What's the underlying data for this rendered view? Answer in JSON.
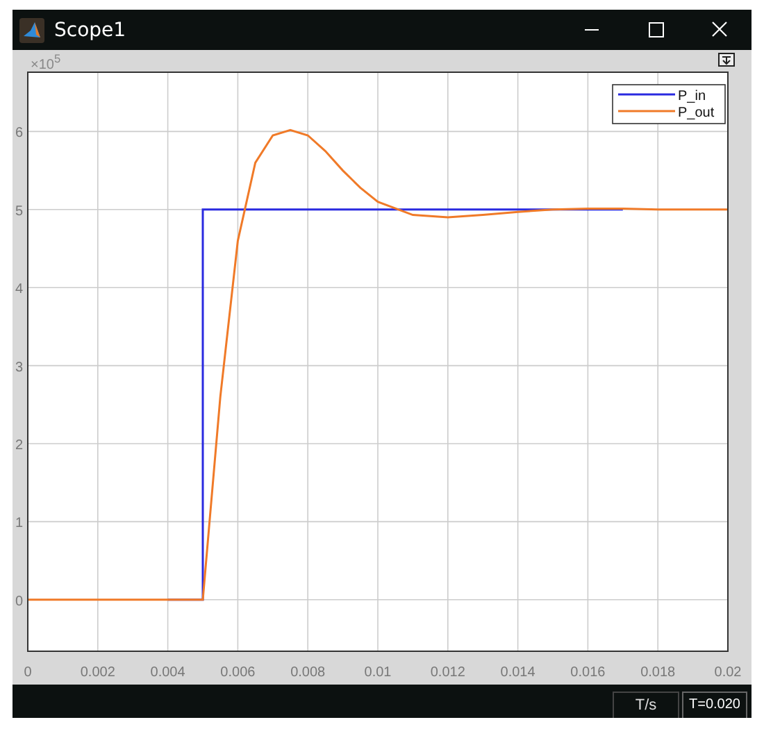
{
  "window": {
    "title": "Scope1"
  },
  "plot": {
    "multiplier": "×10$^{5}$",
    "chart_data": {
      "type": "line",
      "x": [
        0,
        0.001,
        0.002,
        0.003,
        0.004,
        0.005,
        0.005,
        0.0055,
        0.006,
        0.0065,
        0.007,
        0.0075,
        0.008,
        0.0085,
        0.009,
        0.0095,
        0.01,
        0.011,
        0.012,
        0.013,
        0.014,
        0.015,
        0.016,
        0.017,
        0.018,
        0.019,
        0.02
      ],
      "series": [
        {
          "name": "P_in",
          "color": "#2a2ae0",
          "values": [
            null,
            null,
            null,
            null,
            0,
            0,
            5,
            5,
            5,
            5,
            5,
            5,
            5,
            5,
            5,
            5,
            5,
            5,
            5,
            5,
            5,
            5,
            5,
            5,
            null,
            null,
            null
          ]
        },
        {
          "name": "P_out",
          "color": "#f07a28",
          "values": [
            0,
            0,
            0,
            0,
            0,
            0,
            0,
            2.6,
            4.6,
            5.6,
            5.95,
            6.02,
            5.95,
            5.75,
            5.5,
            5.28,
            5.1,
            4.93,
            4.9,
            4.93,
            4.97,
            5.0,
            5.01,
            5.01,
            5.0,
            5.0,
            5.0
          ]
        }
      ],
      "grid": true,
      "legend": true,
      "xlim": [
        0,
        0.02
      ],
      "ylim": [
        -0.66,
        6.76
      ],
      "xticks": [
        {
          "value": 0,
          "label": "0"
        },
        {
          "value": 0.002,
          "label": "0.002"
        },
        {
          "value": 0.004,
          "label": "0.004"
        },
        {
          "value": 0.006,
          "label": "0.006"
        },
        {
          "value": 0.008,
          "label": "0.008"
        },
        {
          "value": 0.01,
          "label": "0.01"
        },
        {
          "value": 0.012,
          "label": "0.012"
        },
        {
          "value": 0.014,
          "label": "0.014"
        },
        {
          "value": 0.016,
          "label": "0.016"
        },
        {
          "value": 0.018,
          "label": "0.018"
        },
        {
          "value": 0.02,
          "label": "0.02"
        }
      ],
      "yticks": [
        {
          "value": 0,
          "label": "0"
        },
        {
          "value": 1,
          "label": "1"
        },
        {
          "value": 2,
          "label": "2"
        },
        {
          "value": 3,
          "label": "3"
        },
        {
          "value": 4,
          "label": "4"
        },
        {
          "value": 5,
          "label": "5"
        },
        {
          "value": 6,
          "label": "6"
        }
      ]
    }
  },
  "status_bar": {
    "time_unit": "T/s",
    "time": "T=0.020"
  }
}
